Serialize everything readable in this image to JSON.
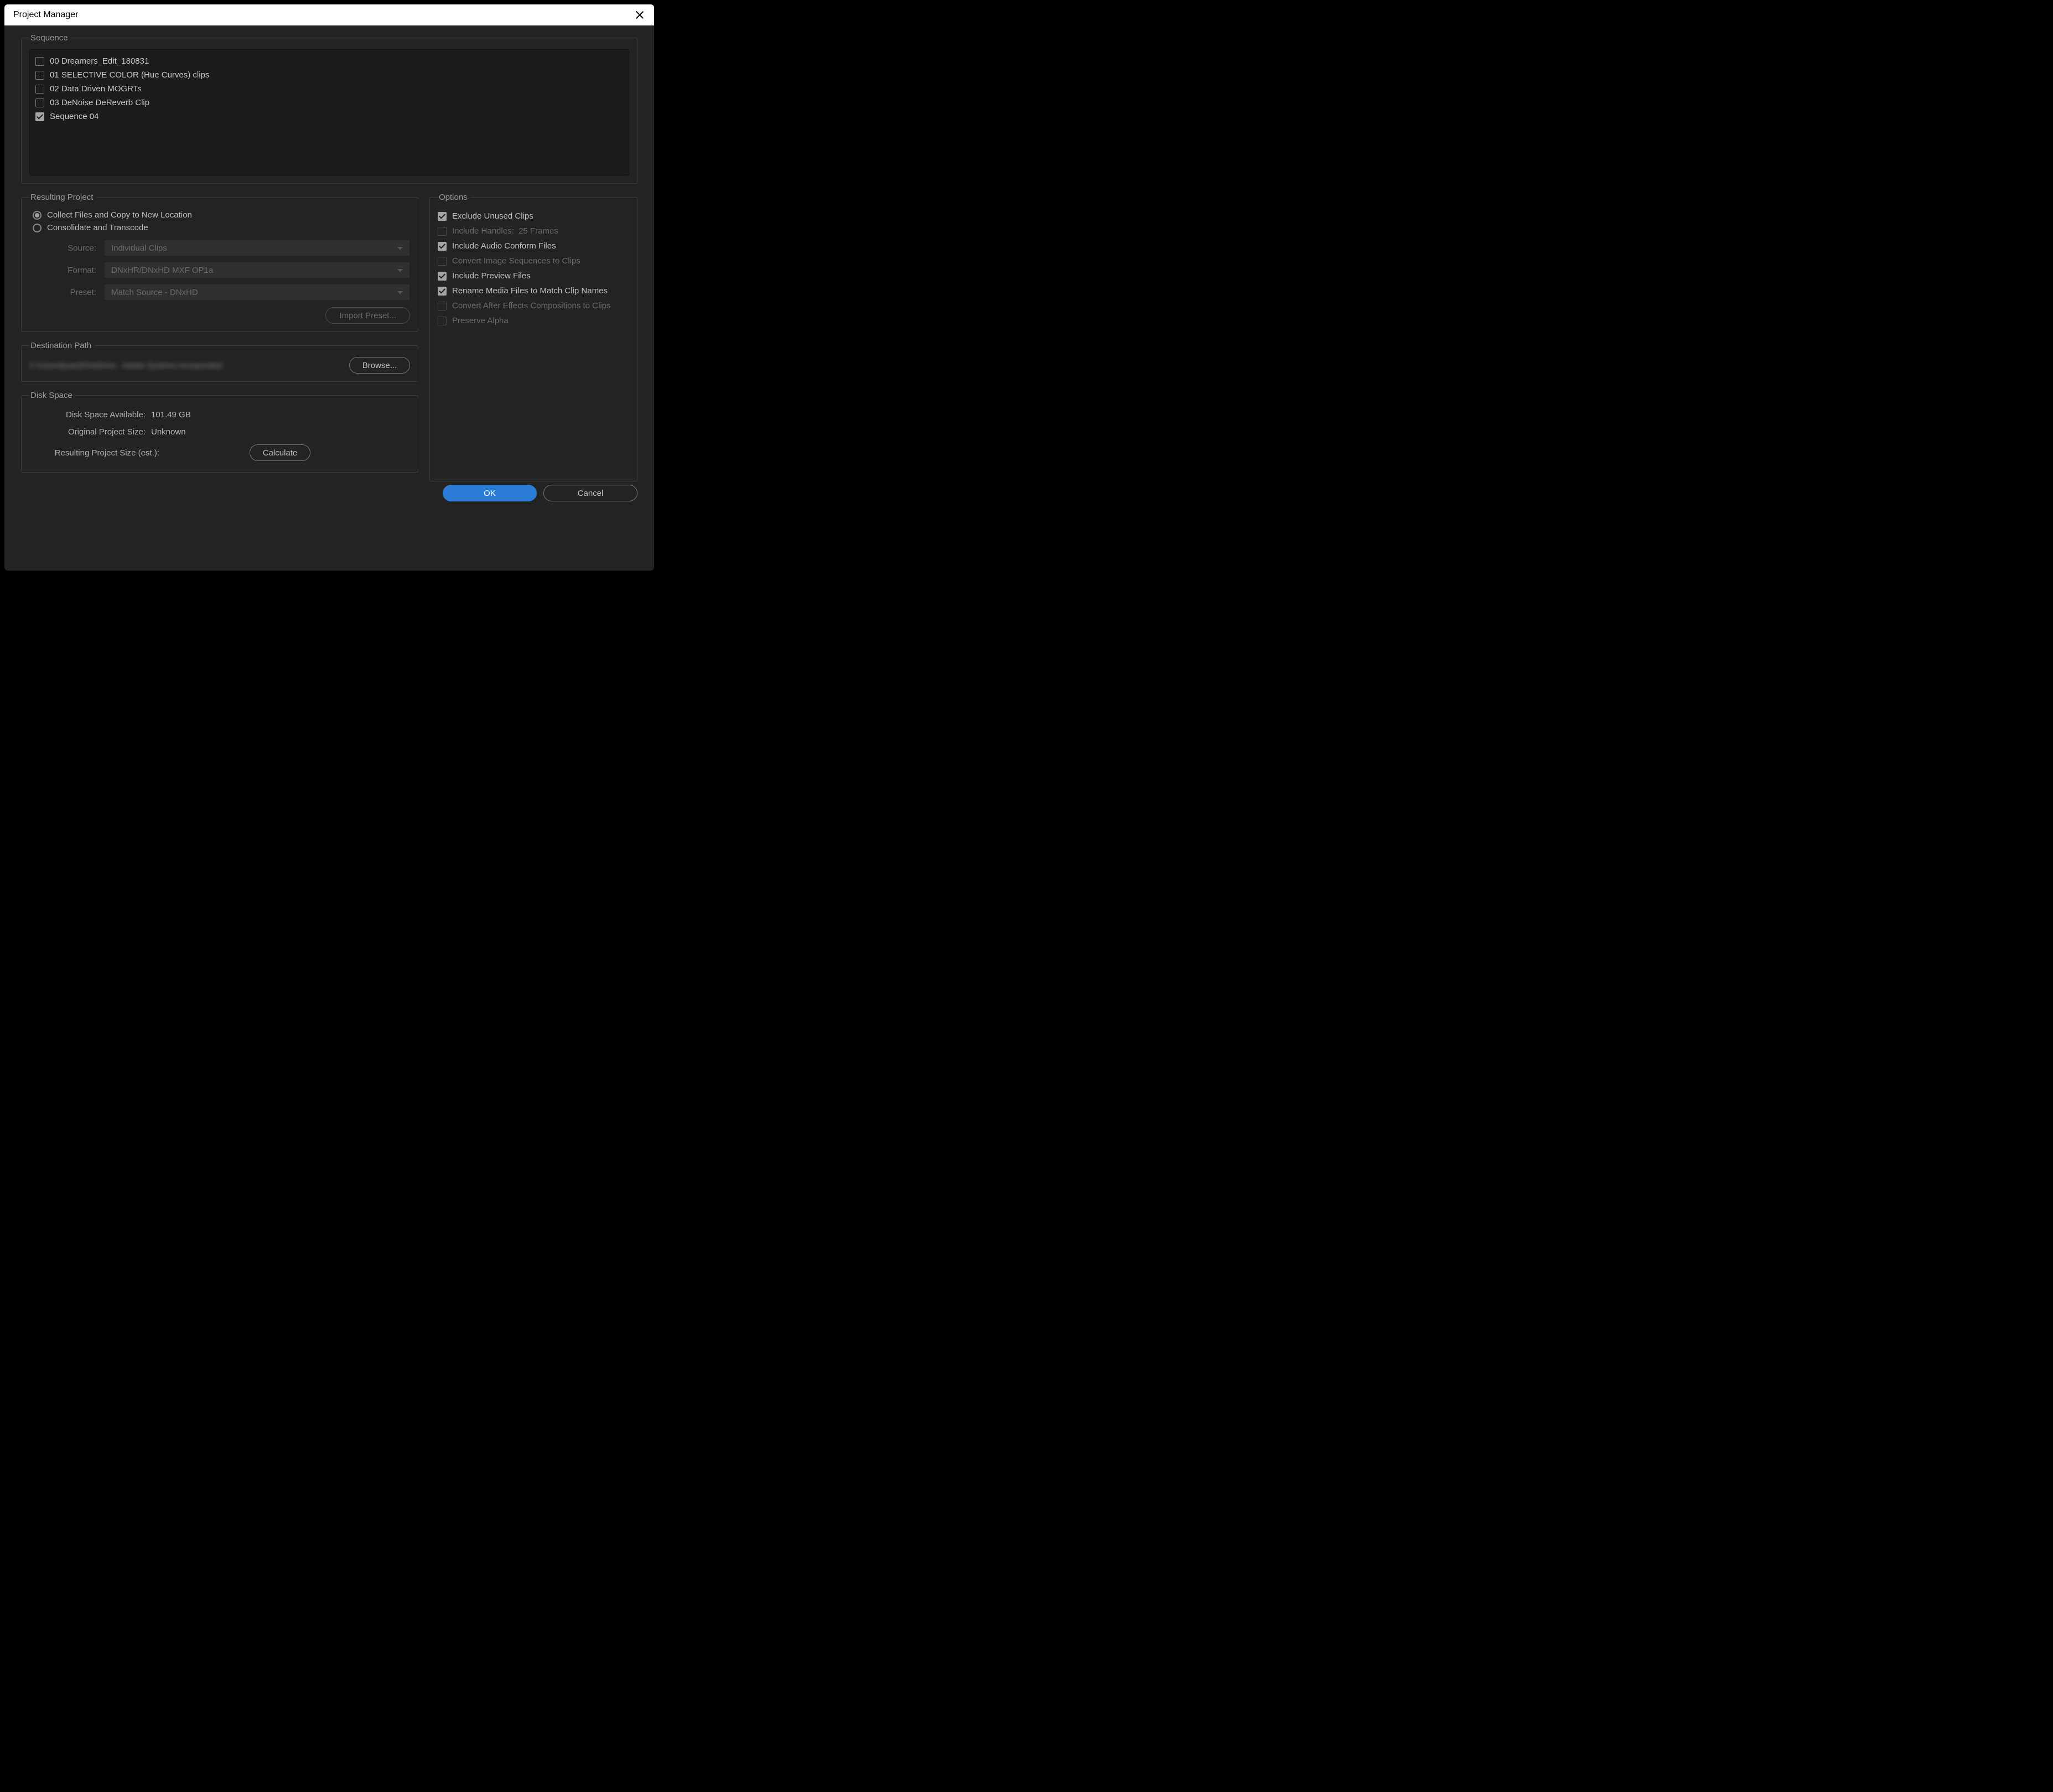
{
  "window": {
    "title": "Project Manager"
  },
  "sequence": {
    "legend": "Sequence",
    "items": [
      {
        "label": "00 Dreamers_Edit_180831",
        "checked": false
      },
      {
        "label": "01 SELECTIVE COLOR (Hue Curves) clips",
        "checked": false
      },
      {
        "label": "02 Data Driven MOGRTs",
        "checked": false
      },
      {
        "label": "03 DeNoise DeReverb Clip",
        "checked": false
      },
      {
        "label": "Sequence 04",
        "checked": true
      }
    ]
  },
  "resulting": {
    "legend": "Resulting Project",
    "radios": {
      "collect": "Collect Files and Copy to New Location",
      "consolidate": "Consolidate and Transcode",
      "selected": "collect"
    },
    "source_label": "Source:",
    "source_value": "Individual Clips",
    "format_label": "Format:",
    "format_value": "DNxHR/DNxHD MXF OP1a",
    "preset_label": "Preset:",
    "preset_value": "Match Source - DNxHD",
    "import_preset": "Import Preset..."
  },
  "destination": {
    "legend": "Destination Path",
    "path": "C:\\Users\\[user]\\OneDrive - Adobe Systems Incorporated",
    "browse": "Browse..."
  },
  "disk": {
    "legend": "Disk Space",
    "avail_label": "Disk Space Available:",
    "avail_value": "101.49 GB",
    "orig_label": "Original Project Size:",
    "orig_value": "Unknown",
    "result_label": "Resulting Project Size (est.):",
    "result_value": "",
    "calculate": "Calculate"
  },
  "options": {
    "legend": "Options",
    "items": [
      {
        "label": "Exclude Unused Clips",
        "checked": true,
        "disabled": false
      },
      {
        "label": "Include Handles:",
        "suffix": "25 Frames",
        "checked": false,
        "disabled": true
      },
      {
        "label": "Include Audio Conform Files",
        "checked": true,
        "disabled": false
      },
      {
        "label": "Convert Image Sequences to Clips",
        "checked": false,
        "disabled": true
      },
      {
        "label": "Include Preview Files",
        "checked": true,
        "disabled": false
      },
      {
        "label": "Rename Media Files to Match Clip Names",
        "checked": true,
        "disabled": false
      },
      {
        "label": "Convert After Effects Compositions to Clips",
        "checked": false,
        "disabled": true
      },
      {
        "label": "Preserve Alpha",
        "checked": false,
        "disabled": true
      }
    ]
  },
  "footer": {
    "ok": "OK",
    "cancel": "Cancel"
  }
}
